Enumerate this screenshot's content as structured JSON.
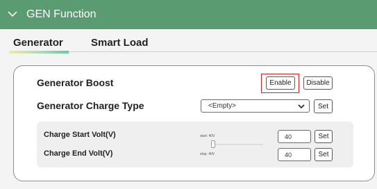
{
  "header": {
    "title": "GEN Function",
    "icon": "chevron-down-icon"
  },
  "tabs": [
    {
      "label": "Generator",
      "active": true
    },
    {
      "label": "Smart Load",
      "active": false
    }
  ],
  "boost": {
    "label": "Generator Boost",
    "enable_label": "Enable",
    "disable_label": "Disable"
  },
  "charge_type": {
    "label": "Generator Charge Type",
    "selected": "<Empty>",
    "set_label": "Set"
  },
  "charge_start": {
    "label": "Charge Start Volt(V)",
    "slider_label": "start: 40V",
    "value": "40",
    "set_label": "Set"
  },
  "charge_end": {
    "label": "Charge End Volt(V)",
    "slider_label": "stop: 40V",
    "value": "40",
    "set_label": "Set"
  },
  "colors": {
    "header": "#5b9b72",
    "highlight_border": "#d42323"
  }
}
